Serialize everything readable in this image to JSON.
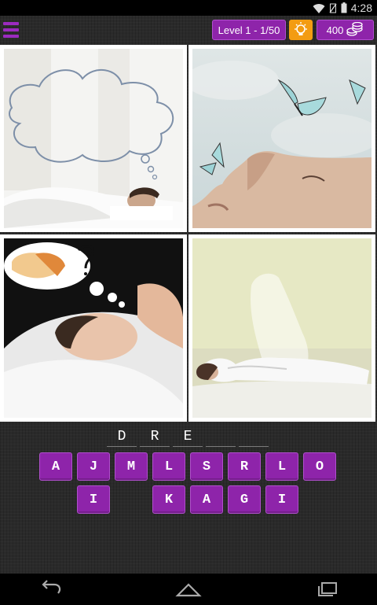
{
  "status_bar": {
    "time": "4:28",
    "icons": [
      "wifi-icon",
      "no-sim-icon",
      "battery-icon"
    ]
  },
  "top_bar": {
    "menu_icon": "hamburger-menu-icon",
    "level_text": "Level 1 - 1/50",
    "hint_icon": "lightbulb-icon",
    "coins_text": "400",
    "coins_icon": "coin-stack-icon"
  },
  "pictures": [
    {
      "subject": "woman sleeping in white bed with empty thought cloud"
    },
    {
      "subject": "woman's face looking up with butterflies"
    },
    {
      "subject": "woman sleeping with thought bubble of bread and question mark"
    },
    {
      "subject": "woman lying on bed with translucent spirit rising"
    }
  ],
  "answer": {
    "slots": [
      "D",
      "R",
      "E",
      "",
      ""
    ]
  },
  "letters": {
    "row1": [
      "A",
      "J",
      "M",
      "L",
      "S",
      "R",
      "L",
      "O"
    ],
    "row2": [
      "I",
      "",
      "K",
      "A",
      "G",
      "I"
    ]
  },
  "colors": {
    "tile": "#8e24aa",
    "hint": "#f39c12",
    "accent": "#9b2bbf"
  },
  "nav_bar": {
    "icons": [
      "back-icon",
      "home-icon",
      "recent-apps-icon"
    ]
  }
}
